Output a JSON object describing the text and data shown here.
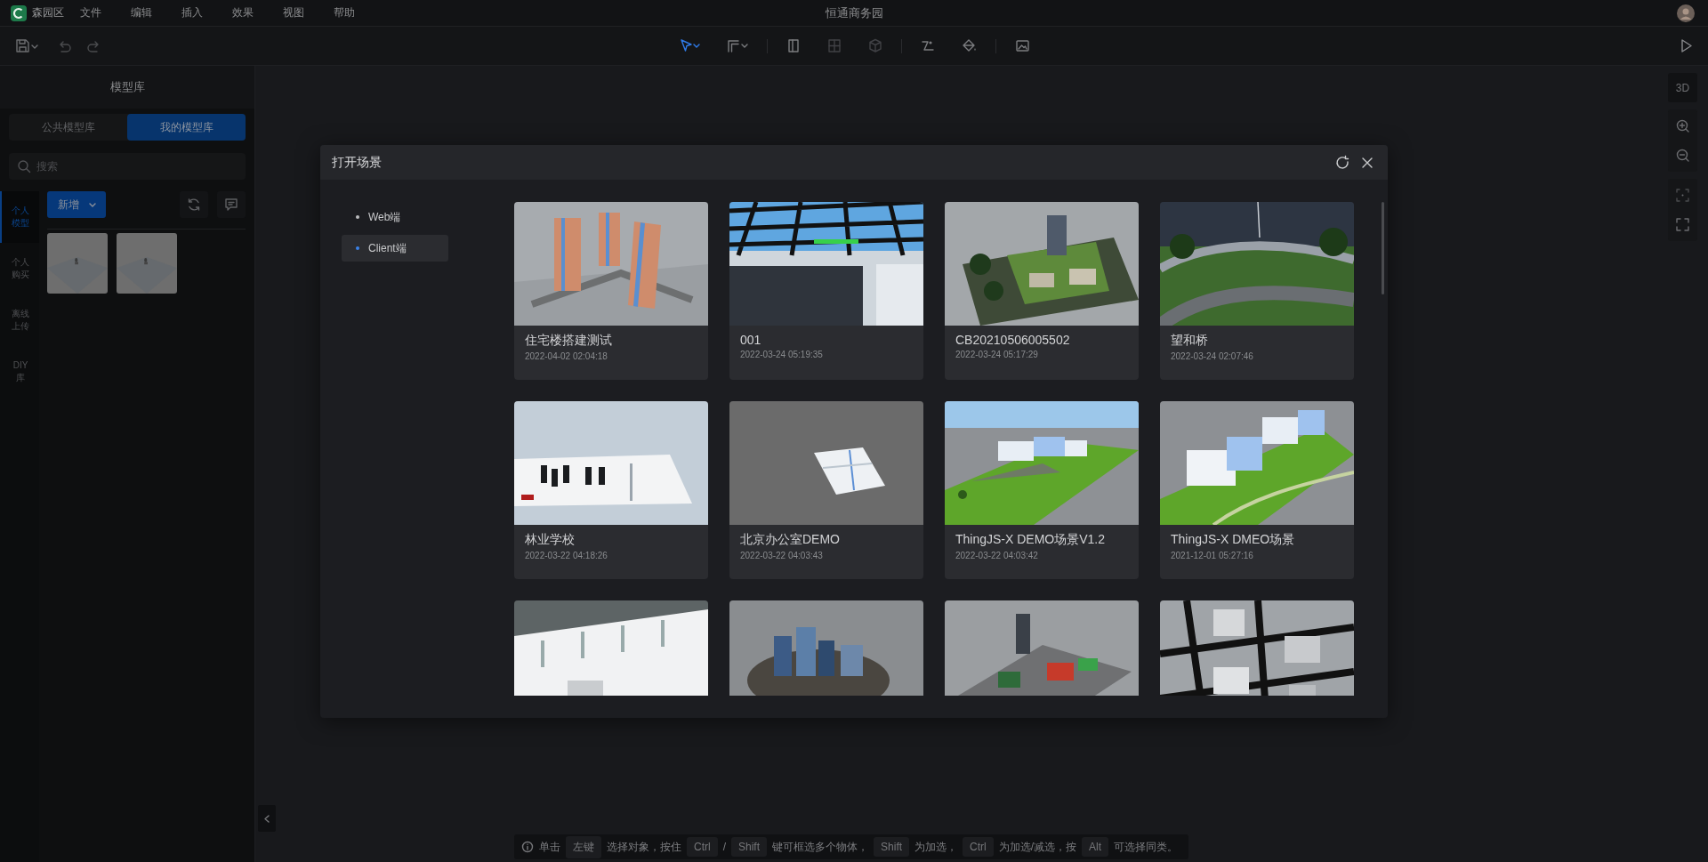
{
  "app": {
    "name": "森园区",
    "menus": [
      "文件",
      "编辑",
      "插入",
      "效果",
      "视图",
      "帮助"
    ],
    "title": "恒通商务园"
  },
  "toolbar": {
    "tools": [
      {
        "selected": true,
        "disabled": false
      },
      {
        "selected": false,
        "disabled": false
      },
      {
        "selected": false,
        "disabled": false
      },
      {
        "selected": false,
        "disabled": true
      },
      {
        "selected": false,
        "disabled": true
      },
      {
        "selected": false,
        "disabled": false
      },
      {
        "selected": false,
        "disabled": false
      },
      {
        "selected": false,
        "disabled": false
      }
    ]
  },
  "model_panel": {
    "title": "模型库",
    "tabs": [
      {
        "label": "公共模型库",
        "selected": false
      },
      {
        "label": "我的模型库",
        "selected": true
      }
    ],
    "search": {
      "placeholder": "搜索"
    },
    "categories": [
      {
        "label": "个人模型",
        "selected": true
      },
      {
        "label": "个人购买",
        "selected": false
      },
      {
        "label": "离线上传",
        "selected": false
      },
      {
        "label": "DIY库",
        "selected": false
      }
    ],
    "add_button": "新增",
    "models": [
      {
        "kind": "picture"
      },
      {
        "kind": "picture"
      }
    ]
  },
  "view_tools": {
    "mode": "3D"
  },
  "dialog": {
    "title": "打开场景",
    "sources": [
      {
        "label": "Web端",
        "selected": false
      },
      {
        "label": "Client端",
        "selected": true
      }
    ],
    "scenes": [
      {
        "kind": "scene",
        "name": "住宅楼搭建测试",
        "date": "2022-04-02 02:04:18"
      },
      {
        "kind": "scene",
        "name": "001",
        "date": "2022-03-24 05:19:35"
      },
      {
        "kind": "scene",
        "name": "CB20210506005502",
        "date": "2022-03-24 05:17:29"
      },
      {
        "kind": "scene",
        "name": "望和桥",
        "date": "2022-03-24 02:07:46"
      },
      {
        "kind": "scene",
        "name": "林业学校",
        "date": "2022-03-22 04:18:26"
      },
      {
        "kind": "scene",
        "name": "北京办公室DEMO",
        "date": "2022-03-22 04:03:43"
      },
      {
        "kind": "scene",
        "name": "ThingJS-X DEMO场景V1.2",
        "date": "2022-03-22 04:03:42"
      },
      {
        "kind": "scene",
        "name": "ThingJS-X DMEO场景",
        "date": "2021-12-01 05:27:16"
      },
      {
        "kind": "picture"
      },
      {
        "kind": "picture"
      },
      {
        "kind": "picture"
      },
      {
        "kind": "picture"
      }
    ]
  },
  "hint": [
    {
      "kind": "text",
      "text": "单击"
    },
    {
      "kind": "key",
      "text": "左键"
    },
    {
      "kind": "text",
      "text": "选择对象，按住"
    },
    {
      "kind": "key",
      "text": "Ctrl"
    },
    {
      "kind": "text",
      "text": "/"
    },
    {
      "kind": "key",
      "text": "Shift"
    },
    {
      "kind": "text",
      "text": "键可框选多个物体，"
    },
    {
      "kind": "key",
      "text": "Shift"
    },
    {
      "kind": "text",
      "text": "为加选，"
    },
    {
      "kind": "key",
      "text": "Ctrl"
    },
    {
      "kind": "text",
      "text": "为加选/减选，按"
    },
    {
      "kind": "key",
      "text": "Alt"
    },
    {
      "kind": "text",
      "text": "可选择同类。"
    }
  ]
}
